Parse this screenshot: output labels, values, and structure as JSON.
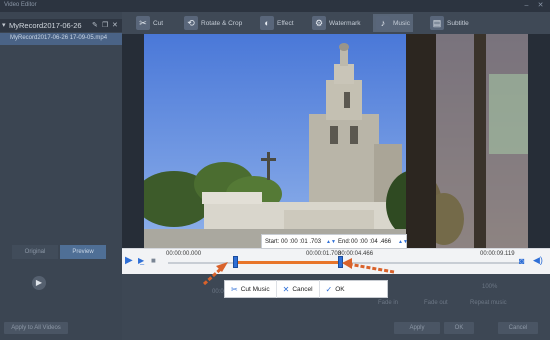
{
  "window": {
    "title": "Video Editor"
  },
  "sidebar": {
    "file_name": "MyRecord2017-06-26",
    "clip_name": "MyRecord2017-06-26 17-09-05.mp4",
    "tabs": [
      "Original",
      "Preview"
    ]
  },
  "toolbar": {
    "items": [
      {
        "label": "Cut",
        "icon": "scissors-icon"
      },
      {
        "label": "Rotate & Crop",
        "icon": "crop-icon"
      },
      {
        "label": "Effect",
        "icon": "effect-icon"
      },
      {
        "label": "Watermark",
        "icon": "watermark-icon"
      },
      {
        "label": "Music",
        "icon": "music-icon"
      },
      {
        "label": "Subtitle",
        "icon": "subtitle-icon"
      }
    ],
    "active": "Music"
  },
  "player": {
    "time_start": "00:00:00.000",
    "time_mid": "00:00:01.703",
    "time_sel_end": "00:00:04.466",
    "time_end": "00:00:09.119",
    "start_progress": 0.19,
    "end_progress": 0.49
  },
  "range_popup": {
    "start_label": "Start:",
    "start_value": "00 :00 :01 .703",
    "end_label": "End:",
    "end_value": "00 :00 :04 .466"
  },
  "actions": {
    "cut": "Cut Music",
    "cancel": "Cancel",
    "ok": "OK"
  },
  "background": {
    "time_label": "00:00:00.000",
    "volume": "100%",
    "check1": "Fade in",
    "check2": "Fade out",
    "check3": "Repeat music",
    "apply_all": "Apply to All Videos",
    "apply": "Apply",
    "ok": "OK",
    "cancel": "Cancel"
  },
  "colors": {
    "accent": "#2f6fd6",
    "selection": "#e8752a",
    "arrow": "#d9622b"
  }
}
